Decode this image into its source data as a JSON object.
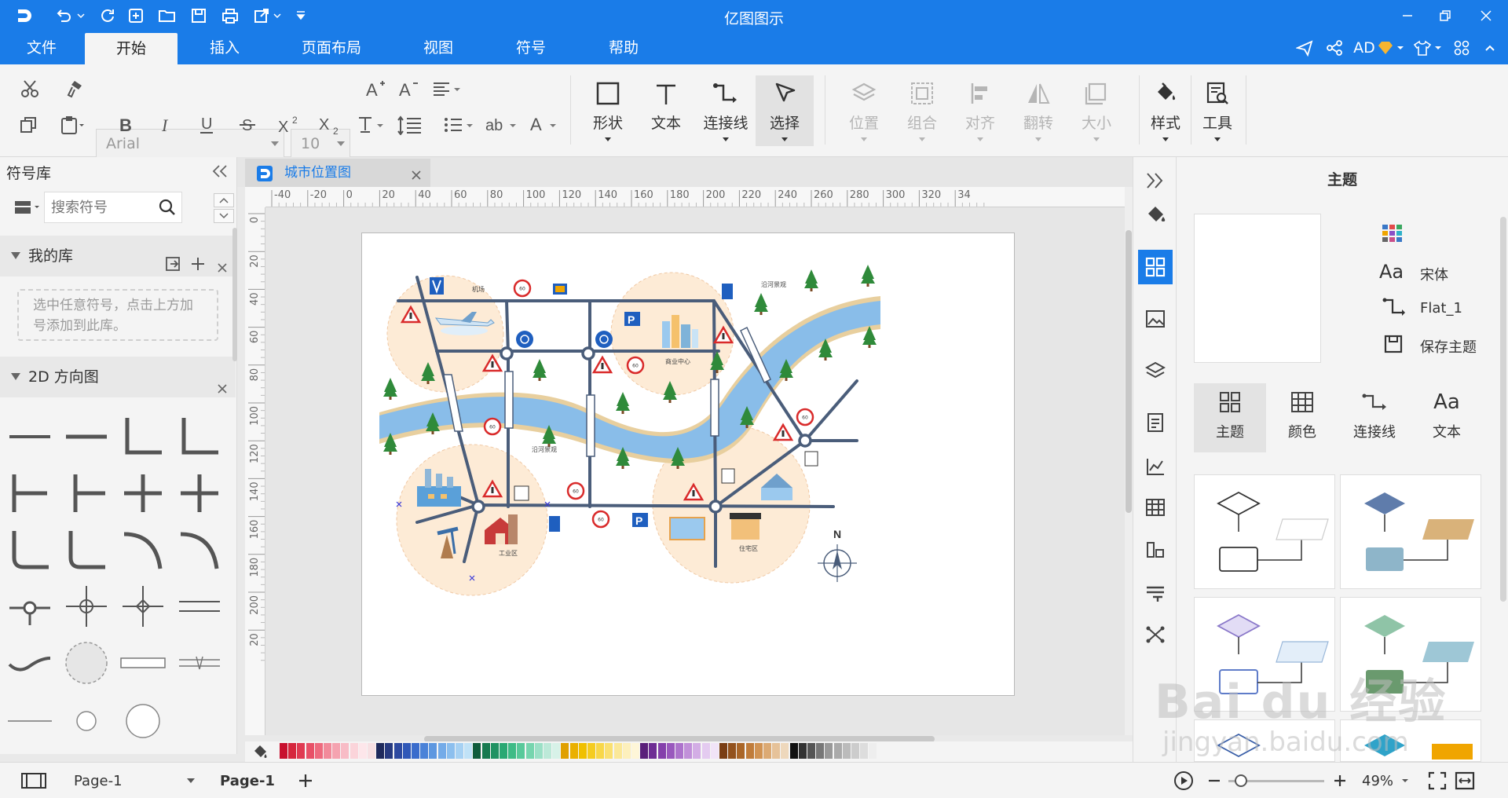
{
  "app": {
    "title": "亿图图示"
  },
  "menus": [
    "文件",
    "开始",
    "插入",
    "页面布局",
    "视图",
    "符号",
    "帮助"
  ],
  "account": {
    "label": "AD"
  },
  "ribbon": {
    "font_name": "Arial",
    "font_size": "10",
    "big_buttons": {
      "shape": "形状",
      "text": "文本",
      "connector": "连接线",
      "select": "选择",
      "position": "位置",
      "group": "组合",
      "align": "对齐",
      "flip": "翻转",
      "size": "大小",
      "style": "样式",
      "tools": "工具"
    }
  },
  "library": {
    "title": "符号库",
    "search_placeholder": "搜索符号",
    "my_library": "我的库",
    "my_library_hint": "选中任意符号，点击上方加号添加到此库。",
    "section_2d": "2D 方向图"
  },
  "document": {
    "tab_title": "城市位置图",
    "map_labels": {
      "airport": "机场",
      "scenic_1": "沿河景观",
      "business": "商业中心",
      "scenic_2": "沿河景观",
      "industrial": "工业区",
      "residential": "住宅区",
      "north": "N",
      "speed": "60"
    }
  },
  "rulers": {
    "h_ticks": [
      "-40",
      "-20",
      "0",
      "20",
      "40",
      "60",
      "80",
      "100",
      "120",
      "140",
      "160",
      "180",
      "200",
      "220",
      "240",
      "260",
      "280",
      "300",
      "320",
      "34"
    ],
    "v_ticks": [
      "0",
      "20",
      "40",
      "60",
      "80",
      "100",
      "120",
      "140",
      "160",
      "180",
      "200",
      "20"
    ]
  },
  "theme_panel": {
    "title": "主题",
    "font_name": "宋体",
    "connector_style": "Flat_1",
    "save_theme": "保存主题",
    "tabs": [
      "主题",
      "颜色",
      "连接线",
      "文本"
    ]
  },
  "status": {
    "page_selector": "Page-1",
    "active_page": "Page-1",
    "zoom": "49%"
  },
  "watermark": {
    "line1": "Bai du 经验",
    "line2": "jingyan.baidu.com"
  },
  "colors": {
    "brand": "#1a7ce8",
    "road": "#4a5d7a",
    "river": "#89bde9",
    "riverbank": "#e8cf9e",
    "zone": "#fdebd6",
    "tree": "#2f8a3a",
    "sign_red": "#d92b2b"
  }
}
